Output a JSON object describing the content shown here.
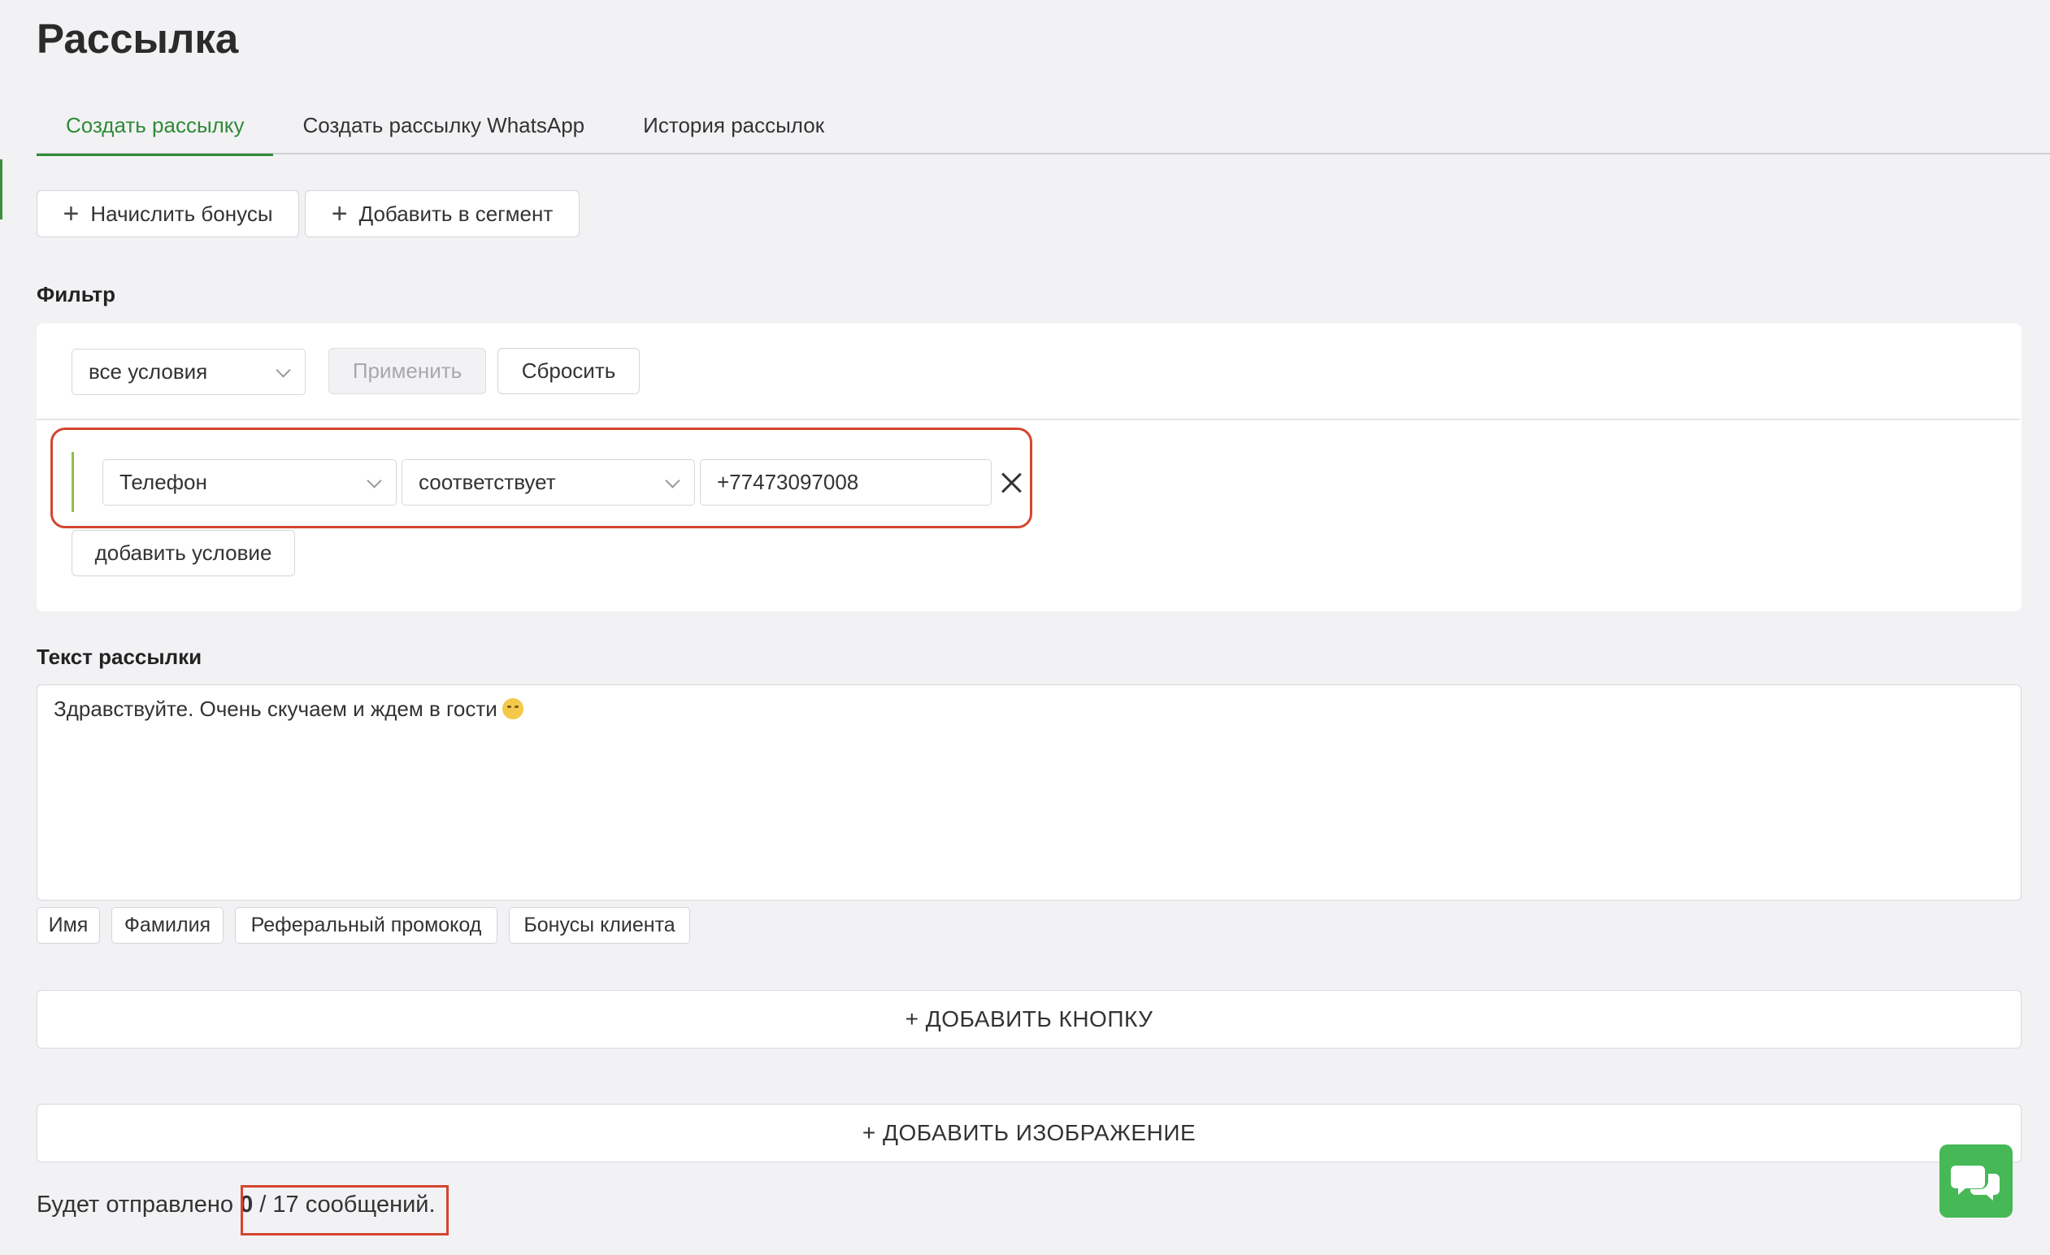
{
  "page": {
    "title": "Рассылка"
  },
  "tabs": [
    {
      "label": "Создать рассылку",
      "active": true
    },
    {
      "label": "Создать рассылку WhatsApp",
      "active": false
    },
    {
      "label": "История рассылок",
      "active": false
    }
  ],
  "actions": {
    "add_bonus": "Начислить бонусы",
    "add_segment": "Добавить в сегмент"
  },
  "filter": {
    "label": "Фильтр",
    "mode": "все условия",
    "apply": "Применить",
    "reset": "Сбросить",
    "condition": {
      "field": "Телефон",
      "operator": "соответствует",
      "value": "+77473097008"
    },
    "add_condition": "добавить условие"
  },
  "message": {
    "label": "Текст рассылки",
    "text": "Здравствуйте. Очень скучаем и ждем в гости",
    "emoji": "smirking-face",
    "variables": [
      "Имя",
      "Фамилия",
      "Реферальный промокод",
      "Бонусы клиента"
    ]
  },
  "add_button": "+ ДОБАВИТЬ КНОПКУ",
  "add_image": "+ ДОБАВИТЬ ИЗОБРАЖЕНИЕ",
  "summary": {
    "prefix": "Будет отправлено",
    "sent": "0",
    "rest": "/ 17 сообщений."
  },
  "colors": {
    "accent": "#2f8a36",
    "highlight": "#d4452f",
    "chat_fab": "#46b856",
    "background": "#f2f2f5"
  },
  "icons": {
    "chat": "chat-bubbles-icon"
  }
}
